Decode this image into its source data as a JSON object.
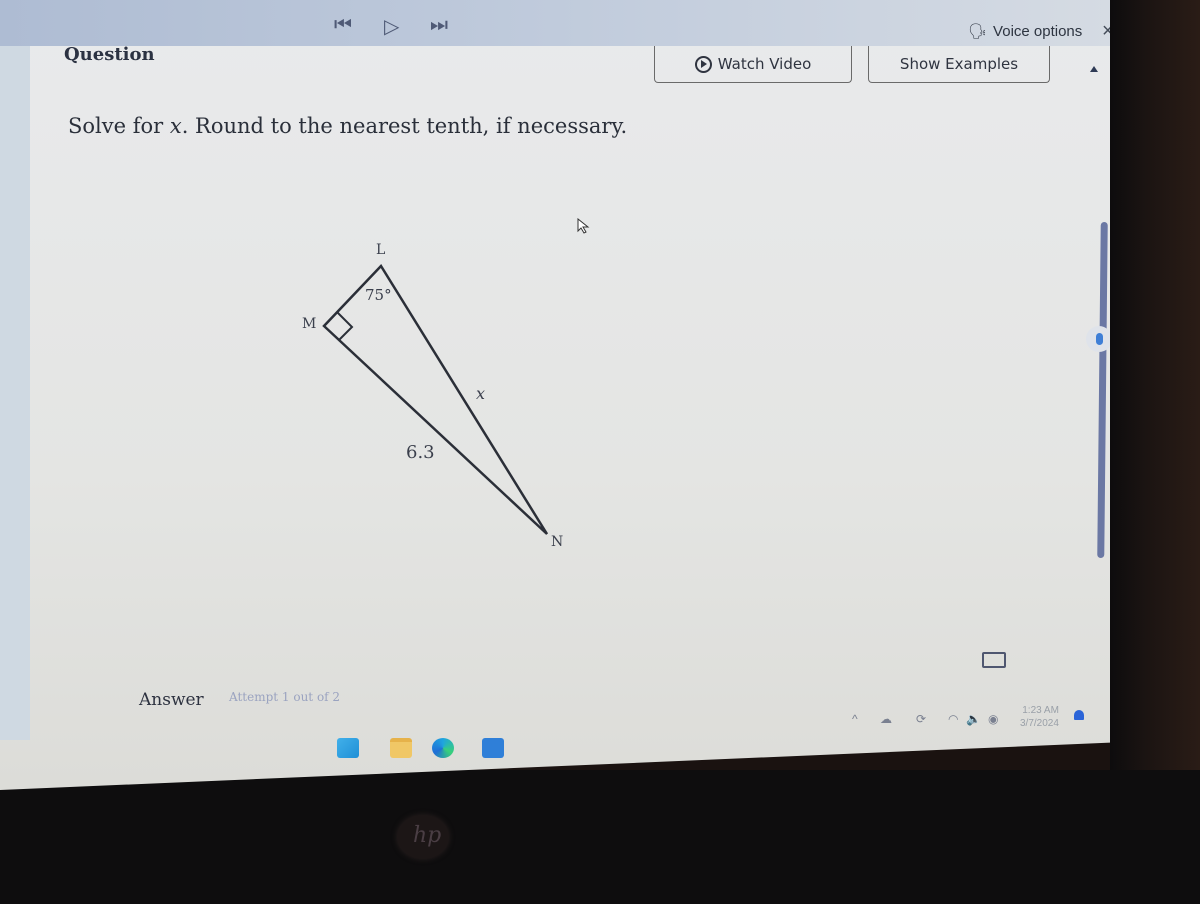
{
  "topbar": {
    "nav": [
      "first-page",
      "play",
      "last-page"
    ],
    "nav_glyphs": {
      "first": "⏮",
      "play": "▷",
      "last": "⏭"
    },
    "voice_options": "Voice options",
    "close": "×"
  },
  "question": {
    "title": "Question",
    "watch_video": "Watch Video",
    "show_examples": "Show Examples",
    "prompt_before": "Solve for ",
    "prompt_var": "x",
    "prompt_after": ". Round to the nearest tenth, if necessary."
  },
  "diagram": {
    "vertices": {
      "L": "L",
      "M": "M",
      "N": "N"
    },
    "angle_L": "75°",
    "side_MN": "6.3",
    "side_LN": "x",
    "right_angle_at": "M"
  },
  "answer": {
    "label": "Answer",
    "attempt": "Attempt 1 out of 2"
  },
  "taskbar": {
    "apps": [
      "windows-start",
      "file-explorer",
      "edge",
      "microsoft-store"
    ],
    "time": "1:23 AM",
    "date": "3/7/2024"
  }
}
